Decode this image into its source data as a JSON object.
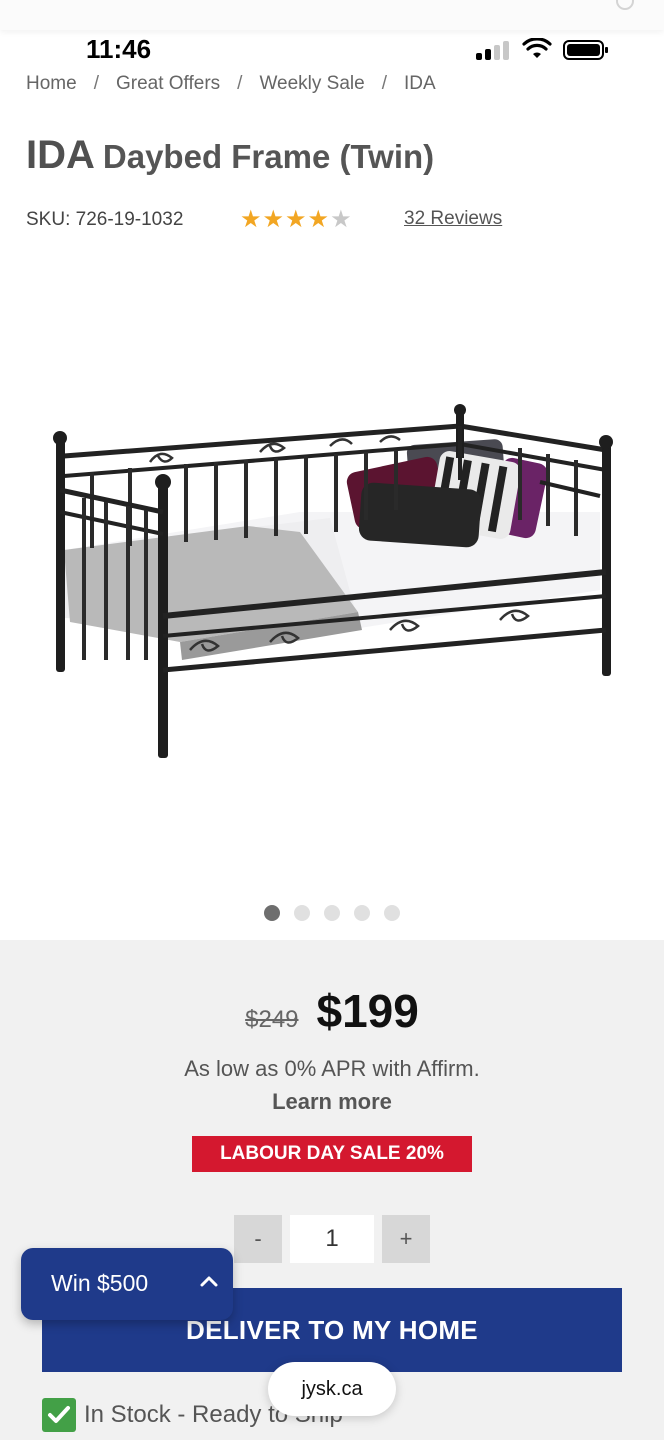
{
  "status_bar": {
    "time": "11:46"
  },
  "breadcrumb": [
    {
      "label": "Home"
    },
    {
      "label": "Great Offers"
    },
    {
      "label": "Weekly Sale"
    },
    {
      "label": "IDA"
    }
  ],
  "breadcrumb_separator": "/",
  "product": {
    "brand": "IDA",
    "name": "Daybed Frame (Twin)",
    "sku": "SKU: 726-19-1032",
    "rating": 4,
    "rating_max": 5,
    "reviews_label": "32 Reviews",
    "image_icon": "daybed-product-image",
    "carousel": {
      "count": 5,
      "active_index": 0
    }
  },
  "pricing": {
    "old_price": "$249",
    "new_price": "$199",
    "affirm_text": "As low as 0% APR with Affirm.",
    "learn_more": "Learn more",
    "sale_badge": "LABOUR DAY SALE 20%"
  },
  "quantity": {
    "minus_label": "-",
    "value": "1",
    "plus_label": "+"
  },
  "actions": {
    "deliver_label": "DELIVER TO MY HOME",
    "win_label": "Win $500"
  },
  "stock": {
    "text": "In Stock - Ready to Ship"
  },
  "browser": {
    "url": "jysk.ca"
  },
  "colors": {
    "primary_blue": "#1f3a8a",
    "sale_red": "#d4182f",
    "star_gold": "#f2a623",
    "stock_green": "#43a047"
  }
}
